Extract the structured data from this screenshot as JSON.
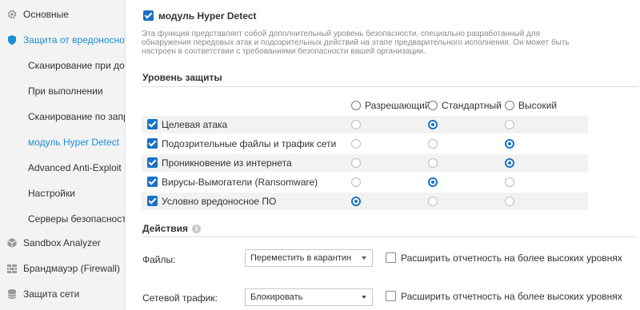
{
  "sidebar": {
    "items": [
      {
        "label": "Основные",
        "icon": "gear-icon"
      },
      {
        "label": "Защита от вредоносного",
        "icon": "shield-icon"
      },
      {
        "label": "Сканирование при дост"
      },
      {
        "label": "При выполнении"
      },
      {
        "label": "Сканирование по запро"
      },
      {
        "label": "модуль Hyper Detect"
      },
      {
        "label": "Advanced Anti-Exploit"
      },
      {
        "label": "Настройки"
      },
      {
        "label": "Серверы безопасности"
      },
      {
        "label": "Sandbox Analyzer",
        "icon": "cube-icon"
      },
      {
        "label": "Брандмауэр (Firewall)",
        "icon": "firewall-icon"
      },
      {
        "label": "Защита сети",
        "icon": "database-icon"
      }
    ]
  },
  "module": {
    "title": "модуль Hyper Detect",
    "enabled": true,
    "description": "Эта функция представляет собой дополнительный уровень безопасности, специально разработанный для обнаружения передовых атак и подозрительных действий на этапе предварительного исполнения. Он может быть настроен в соответствии с требованиями безопасности вашей организации."
  },
  "protection": {
    "title": "Уровень защиты",
    "levels": [
      "Разрешающий",
      "Стандартный",
      "Высокий"
    ],
    "rows": [
      {
        "label": "Целевая атака",
        "checked": true,
        "level": 1
      },
      {
        "label": "Подозрительные файлы и трафик сети",
        "checked": true,
        "level": 2
      },
      {
        "label": "Проникновение из интернета",
        "checked": true,
        "level": 2
      },
      {
        "label": "Вирусы-Вымогатели (Ransomware)",
        "checked": true,
        "level": 1
      },
      {
        "label": "Условно вредоносное ПО",
        "checked": true,
        "level": 0
      }
    ]
  },
  "actions": {
    "title": "Действия",
    "info_icon": "info-icon",
    "rows": [
      {
        "label": "Файлы:",
        "value": "Переместить в карантин",
        "extend_label": "Расширить отчетность на более высоких уровнях",
        "extend_checked": false
      },
      {
        "label": "Сетевой трафик:",
        "value": "Блокировать",
        "extend_label": "Расширить отчетность на более высоких уровнях",
        "extend_checked": false
      }
    ]
  },
  "colors": {
    "accent": "#1a8fd6",
    "checkbox": "#1a72c4"
  }
}
